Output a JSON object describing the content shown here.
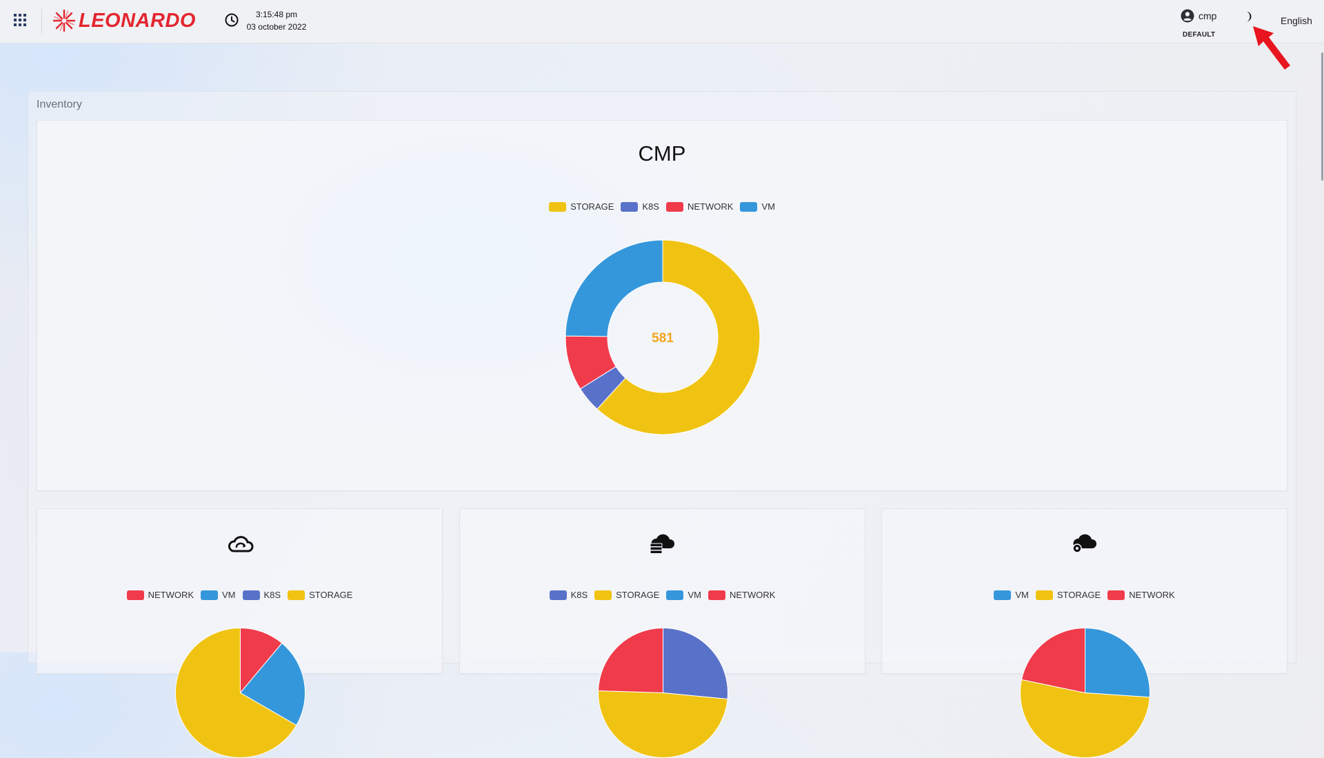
{
  "header": {
    "brand": "LEONARDO",
    "time": "3:15:48 pm",
    "date": "03 october 2022",
    "user": {
      "name": "cmp",
      "role": "DEFAULT"
    },
    "language": "English",
    "icons": {
      "apps": "apps-grid-icon",
      "clock": "clock-icon",
      "user": "user-account-icon",
      "theme": "moon-icon"
    }
  },
  "inventory": {
    "title": "Inventory",
    "main_chart": {
      "title": "CMP",
      "total": "581"
    },
    "cards": [
      {
        "icon": "cloud-sync-icon"
      },
      {
        "icon": "cloud-server-icon"
      },
      {
        "icon": "cloud-settings-icon"
      }
    ]
  },
  "colors": {
    "STORAGE": "#f0c313",
    "K8S": "#5972c9",
    "NETWORK": "#f03b4b",
    "VM": "#3597db",
    "brand_red": "#e3262f",
    "total_orange": "#f5a31a"
  },
  "chart_data": [
    {
      "type": "pie",
      "title": "CMP",
      "donut": true,
      "center_label": "581",
      "legend_position": "top",
      "labels": [
        "STORAGE",
        "K8S",
        "NETWORK",
        "VM"
      ],
      "values": [
        359,
        25,
        53,
        144
      ]
    },
    {
      "type": "pie",
      "title": "",
      "legend_position": "top",
      "labels": [
        "NETWORK",
        "VM",
        "K8S",
        "STORAGE"
      ],
      "values": [
        4,
        8,
        0,
        24
      ]
    },
    {
      "type": "pie",
      "title": "",
      "legend_position": "top",
      "labels": [
        "K8S",
        "STORAGE",
        "VM",
        "NETWORK"
      ],
      "values": [
        13,
        24,
        0,
        12
      ]
    },
    {
      "type": "pie",
      "title": "",
      "legend_position": "top",
      "labels": [
        "VM",
        "STORAGE",
        "NETWORK"
      ],
      "values": [
        12,
        24,
        10
      ]
    }
  ]
}
